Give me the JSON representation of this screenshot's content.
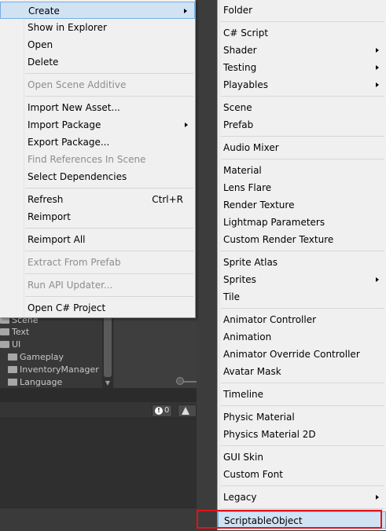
{
  "context_menu": {
    "items": [
      {
        "label": "Create"
      },
      {
        "label": "Show in Explorer"
      },
      {
        "label": "Open"
      },
      {
        "label": "Delete"
      },
      {
        "label": "Open Scene Additive"
      },
      {
        "label": "Import New Asset..."
      },
      {
        "label": "Import Package"
      },
      {
        "label": "Export Package..."
      },
      {
        "label": "Find References In Scene"
      },
      {
        "label": "Select Dependencies"
      },
      {
        "label": "Refresh",
        "shortcut": "Ctrl+R"
      },
      {
        "label": "Reimport"
      },
      {
        "label": "Reimport All"
      },
      {
        "label": "Extract From Prefab"
      },
      {
        "label": "Run API Updater..."
      },
      {
        "label": "Open C# Project"
      }
    ]
  },
  "create_submenu": {
    "items": [
      {
        "label": "Folder"
      },
      {
        "label": "C# Script"
      },
      {
        "label": "Shader"
      },
      {
        "label": "Testing"
      },
      {
        "label": "Playables"
      },
      {
        "label": "Scene"
      },
      {
        "label": "Prefab"
      },
      {
        "label": "Audio Mixer"
      },
      {
        "label": "Material"
      },
      {
        "label": "Lens Flare"
      },
      {
        "label": "Render Texture"
      },
      {
        "label": "Lightmap Parameters"
      },
      {
        "label": "Custom Render Texture"
      },
      {
        "label": "Sprite Atlas"
      },
      {
        "label": "Sprites"
      },
      {
        "label": "Tile"
      },
      {
        "label": "Animator Controller"
      },
      {
        "label": "Animation"
      },
      {
        "label": "Animator Override Controller"
      },
      {
        "label": "Avatar Mask"
      },
      {
        "label": "Timeline"
      },
      {
        "label": "Physic Material"
      },
      {
        "label": "Physics Material 2D"
      },
      {
        "label": "GUI Skin"
      },
      {
        "label": "Custom Font"
      },
      {
        "label": "Legacy"
      },
      {
        "label": "ScriptableObject"
      }
    ]
  },
  "project_tree": {
    "items": [
      {
        "label": "Scene"
      },
      {
        "label": "Text"
      },
      {
        "label": "UI"
      },
      {
        "label": "Gameplay"
      },
      {
        "label": "InventoryManager"
      },
      {
        "label": "Language"
      }
    ]
  },
  "console": {
    "error_count": "0"
  },
  "colors": {
    "menu_bg": "#f0f0f0",
    "hover_bg": "#d1e2f2",
    "hover_border": "#78aee5",
    "highlight_border": "#e0141a",
    "editor_bg": "#3c3c3c"
  },
  "icons": [
    "folder-icon",
    "submenu-arrow-icon",
    "error-icon",
    "warning-icon"
  ]
}
